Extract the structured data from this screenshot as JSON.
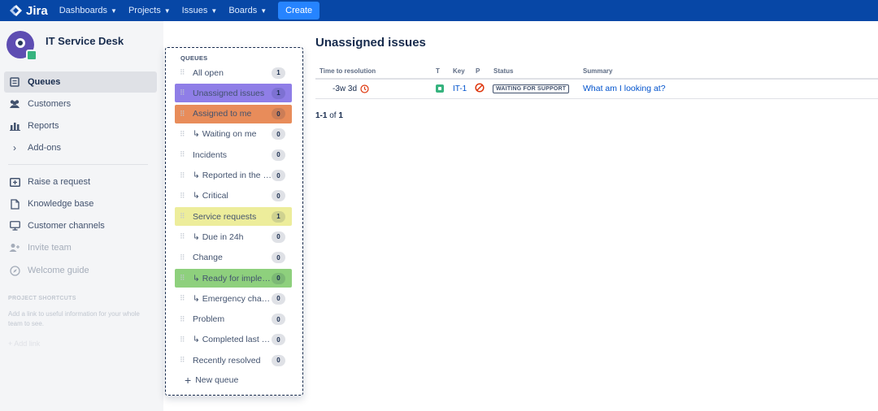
{
  "topnav": {
    "brand": "Jira",
    "items": [
      "Dashboards",
      "Projects",
      "Issues",
      "Boards"
    ],
    "create_label": "Create"
  },
  "sidebar": {
    "project_name": "IT Service Desk",
    "items": [
      {
        "label": "Queues",
        "icon": "queues-icon"
      },
      {
        "label": "Customers",
        "icon": "customers-icon"
      },
      {
        "label": "Reports",
        "icon": "reports-icon"
      },
      {
        "label": "Add-ons",
        "icon": "chevron-right-icon"
      },
      {
        "label": "Raise a request",
        "icon": "raise-request-icon"
      },
      {
        "label": "Knowledge base",
        "icon": "knowledge-base-icon"
      },
      {
        "label": "Customer channels",
        "icon": "monitor-icon"
      },
      {
        "label": "Invite team",
        "icon": "invite-team-icon"
      },
      {
        "label": "Welcome guide",
        "icon": "compass-icon"
      }
    ],
    "shortcuts_title": "PROJECT SHORTCUTS",
    "shortcuts_text": "Add a link to useful information for your whole team to see.",
    "add_link": "Add link"
  },
  "queues": {
    "title": "QUEUES",
    "items": [
      {
        "label": "All open",
        "count": "1",
        "color": ""
      },
      {
        "label": "Unassigned issues",
        "count": "1",
        "color": "#8f7ee7"
      },
      {
        "label": "Assigned to me",
        "count": "0",
        "color": "#e88c5a"
      },
      {
        "label": "↳ Waiting on me",
        "count": "0",
        "color": ""
      },
      {
        "label": "Incidents",
        "count": "0",
        "color": ""
      },
      {
        "label": "↳ Reported in the last hour",
        "count": "0",
        "color": ""
      },
      {
        "label": "↳ Critical",
        "count": "0",
        "color": ""
      },
      {
        "label": "Service requests",
        "count": "1",
        "color": "#eded9b"
      },
      {
        "label": "↳ Due in 24h",
        "count": "0",
        "color": ""
      },
      {
        "label": "Change",
        "count": "0",
        "color": ""
      },
      {
        "label": "↳ Ready for implementation",
        "count": "0",
        "color": "#8ed07d"
      },
      {
        "label": "↳ Emergency changes",
        "count": "0",
        "color": ""
      },
      {
        "label": "Problem",
        "count": "0",
        "color": ""
      },
      {
        "label": "↳ Completed last week",
        "count": "0",
        "color": ""
      },
      {
        "label": "Recently resolved",
        "count": "0",
        "color": ""
      }
    ],
    "new_queue": "New queue"
  },
  "main": {
    "title": "Unassigned issues",
    "columns": [
      "Time to resolution",
      "T",
      "Key",
      "P",
      "Status",
      "Summary"
    ],
    "rows": [
      {
        "time_to_resolution": "-3w 3d",
        "key": "IT-1",
        "status": "WAITING FOR SUPPORT",
        "summary": "What am I looking at?"
      }
    ],
    "pager_range": "1-1",
    "pager_of": "of",
    "pager_total": "1"
  },
  "colors": {
    "nav_bg": "#0747a6",
    "create_btn": "#2684ff",
    "link": "#0052cc",
    "sidebar_bg": "#f4f5f7"
  }
}
